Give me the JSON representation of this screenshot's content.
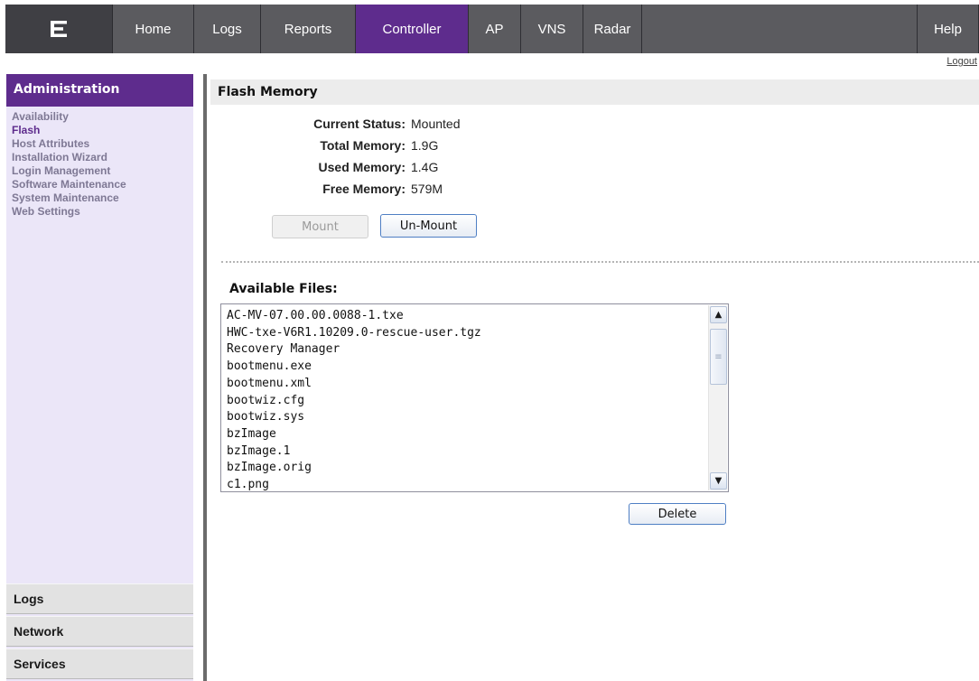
{
  "nav": {
    "tabs": [
      "Home",
      "Logs",
      "Reports",
      "Controller",
      "AP",
      "VNS",
      "Radar"
    ],
    "active_tab": "Controller",
    "help": "Help",
    "logout": "Logout"
  },
  "sidebar": {
    "header": "Administration",
    "items": [
      "Availability",
      "Flash",
      "Host Attributes",
      "Installation Wizard",
      "Login Management",
      "Software Maintenance",
      "System Maintenance",
      "Web Settings"
    ],
    "active_item": "Flash",
    "sections": [
      "Logs",
      "Network",
      "Services"
    ]
  },
  "main": {
    "title": "Flash Memory",
    "status": {
      "current_status_label": "Current Status:",
      "current_status_value": "Mounted",
      "total_label": "Total Memory:",
      "total_value": "1.9G",
      "used_label": "Used Memory:",
      "used_value": "1.4G",
      "free_label": "Free Memory:",
      "free_value": "579M"
    },
    "mount_button": "Mount",
    "unmount_button": "Un-Mount",
    "files_label": "Available Files:",
    "files": [
      "AC-MV-07.00.00.0088-1.txe",
      "HWC-txe-V6R1.10209.0-rescue-user.tgz",
      "Recovery Manager",
      "bootmenu.exe",
      "bootmenu.xml",
      "bootwiz.cfg",
      "bootwiz.sys",
      "bzImage",
      "bzImage.1",
      "bzImage.orig",
      "c1.png"
    ],
    "delete_button": "Delete"
  },
  "colors": {
    "accent_purple": "#5e2c8d",
    "nav_gray": "#5b5b5f",
    "sidebar_bg": "#ebe6f8"
  }
}
